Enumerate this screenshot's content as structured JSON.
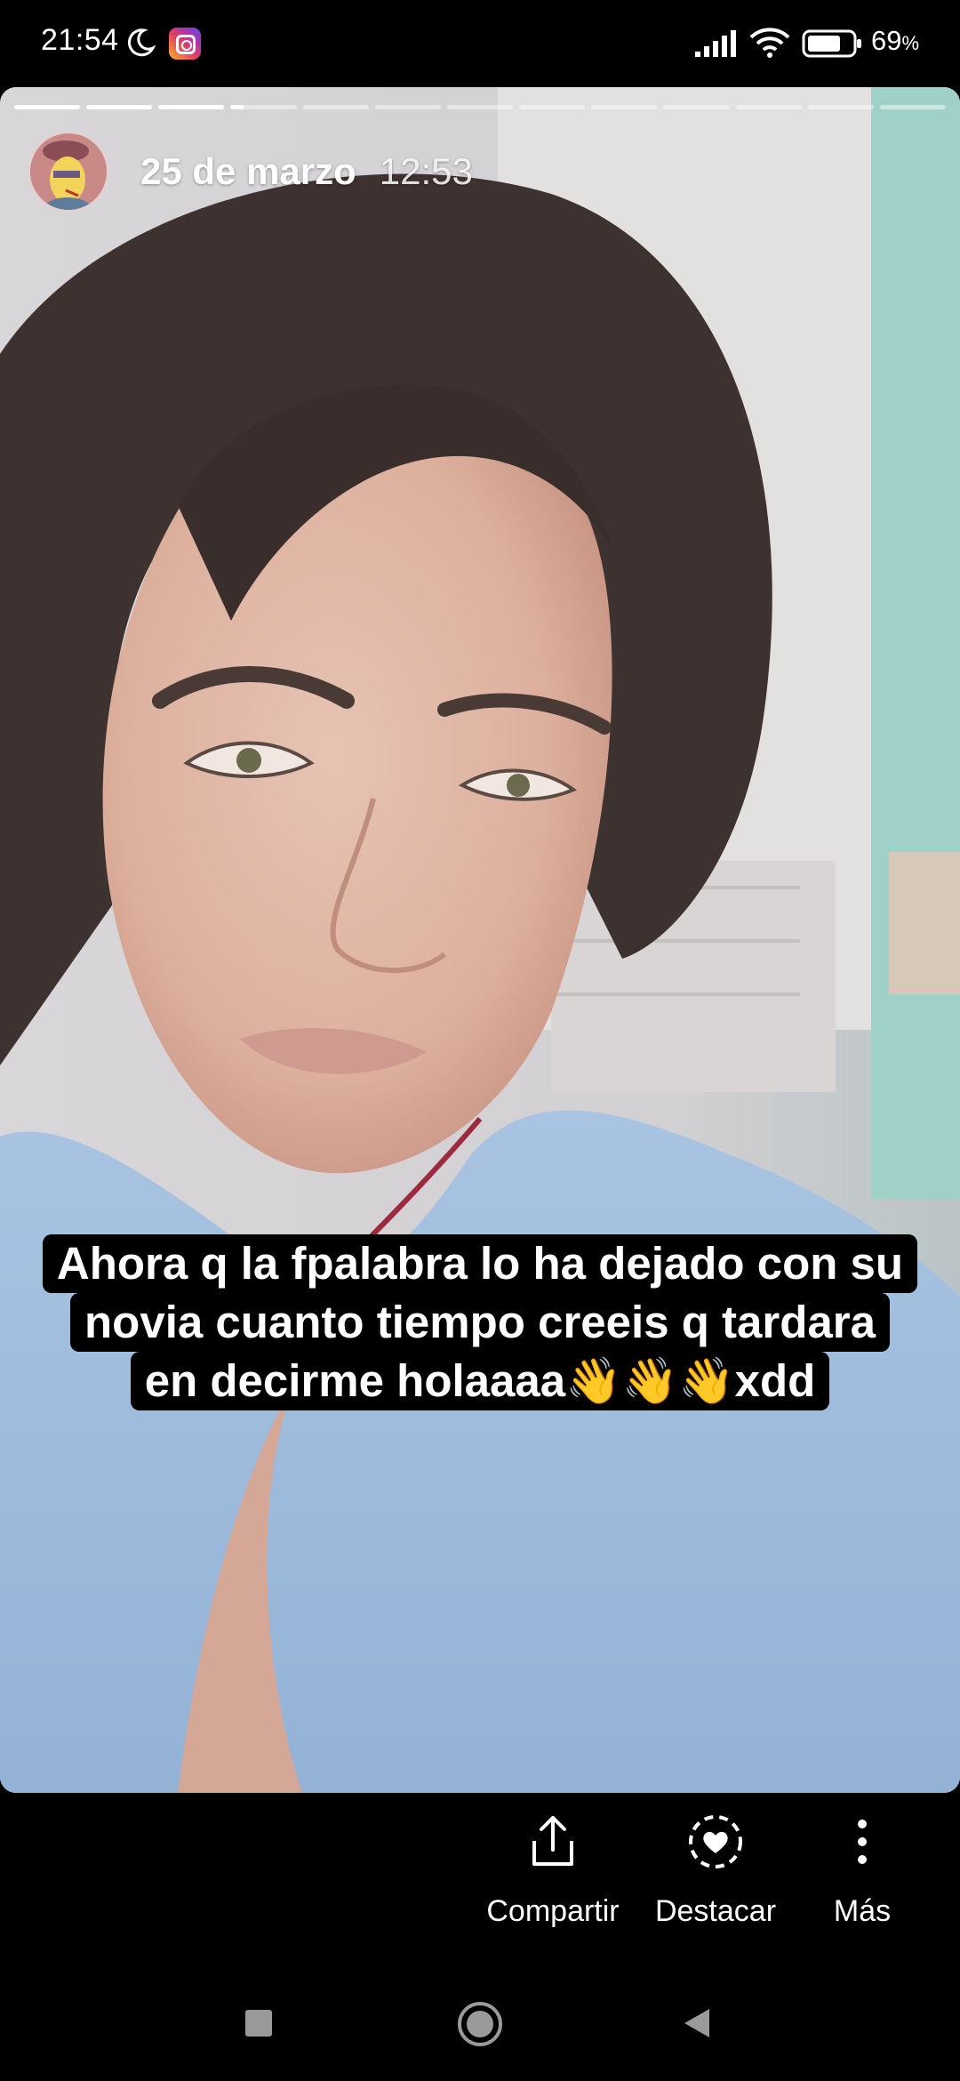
{
  "status_bar": {
    "time": "21:54",
    "battery": "69",
    "battery_suffix": "%",
    "icons": [
      "moon-icon",
      "instagram-notification-icon",
      "signal-icon",
      "wifi-icon",
      "battery-icon"
    ]
  },
  "story": {
    "progress": {
      "segment_count": 13,
      "completed_segments": 3,
      "current_segment_fraction": 0.2
    },
    "date": "25 de marzo",
    "time": "12:53",
    "caption_lines": [
      "Ahora q la fpalabra lo ha dejado con su",
      "novia cuanto tiempo creeis q tardara",
      "en decirme holaaaa👋👋👋xdd"
    ]
  },
  "actions": {
    "share": {
      "label": "Compartir",
      "icon": "share-icon"
    },
    "highlight": {
      "label": "Destacar",
      "icon": "highlight-heart-icon"
    },
    "more": {
      "label": "Más",
      "icon": "more-vertical-icon"
    }
  },
  "nav_bar": {
    "icons": [
      "recents-icon",
      "home-icon",
      "back-icon"
    ]
  },
  "colors": {
    "background": "#000000",
    "caption_background": "#000000",
    "text": "#ffffff"
  }
}
